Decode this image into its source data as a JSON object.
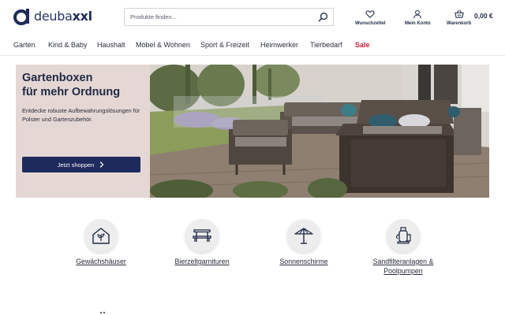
{
  "brand": {
    "name_part1": "deuba",
    "name_part2": "xxl",
    "color": "#1f2a5c"
  },
  "search": {
    "placeholder": "Produkte finden...",
    "icon": "search-icon"
  },
  "header_actions": [
    {
      "label": "Wunschzettel",
      "icon": "heart-icon"
    },
    {
      "label": "Mein Konto",
      "icon": "user-icon"
    },
    {
      "label": "Warenkorb",
      "icon": "basket-icon"
    }
  ],
  "cart_total": "0,00 €",
  "nav": [
    {
      "label": "Garten"
    },
    {
      "label": "Kind & Baby"
    },
    {
      "label": "Haushalt"
    },
    {
      "label": "Möbel & Wohnen"
    },
    {
      "label": "Sport & Freizeit"
    },
    {
      "label": "Heimwerker"
    },
    {
      "label": "Tierbedarf"
    },
    {
      "label": "Sale",
      "color": "#d0203a"
    }
  ],
  "hero": {
    "title_line1": "Gartenboxen",
    "title_line2": "für mehr Ordnung",
    "subtitle": "Entdecke robuste Aufbewahrungslösungen für Polster und Gartenzubehör.",
    "cta": "Jetzt shoppen",
    "panel_color": "#e5d7d4"
  },
  "categories": [
    {
      "label": "Gewächshäuser",
      "icon": "greenhouse-icon"
    },
    {
      "label": "Bierzeltgarnituren",
      "icon": "beer-table-icon"
    },
    {
      "label": "Sonnenschirme",
      "icon": "parasol-icon"
    },
    {
      "label_line1": "Sandfilteranlagen &",
      "label_line2": "Poolpumpen",
      "icon": "sand-filter-icon"
    }
  ]
}
